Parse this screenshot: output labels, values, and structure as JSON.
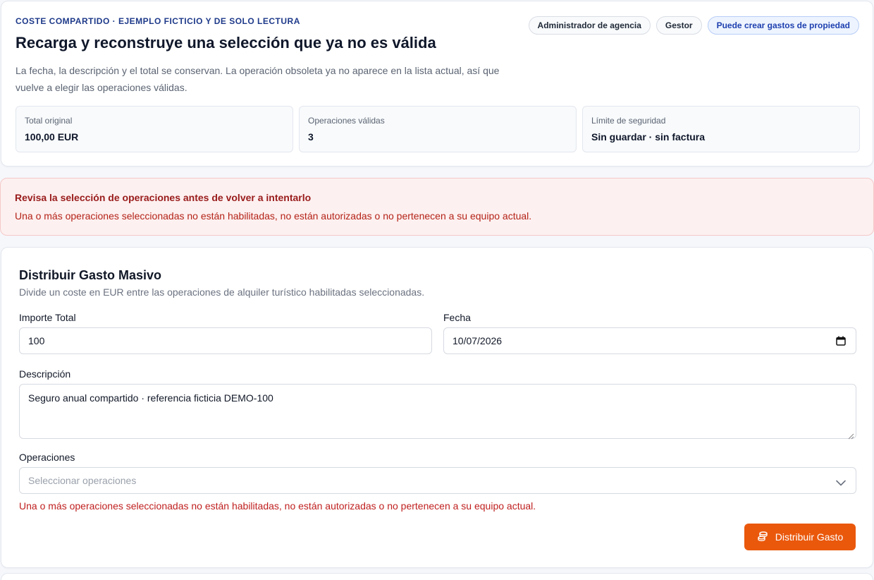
{
  "header": {
    "eyebrow": "COSTE COMPARTIDO · EJEMPLO FICTICIO Y DE SOLO LECTURA",
    "title": "Recarga y reconstruye una selección que ya no es válida",
    "subtitle": "La fecha, la descripción y el total se conservan. La operación obsoleta ya no aparece en la lista actual, así que vuelve a elegir las operaciones válidas.",
    "chips": [
      "Administrador de agencia",
      "Gestor",
      "Puede crear gastos de propiedad"
    ],
    "stats": [
      {
        "label": "Total original",
        "value": "100,00 EUR"
      },
      {
        "label": "Operaciones válidas",
        "value": "3"
      },
      {
        "label": "Límite de seguridad",
        "value": "Sin guardar · sin factura"
      }
    ]
  },
  "alert": {
    "title": "Revisa la selección de operaciones antes de volver a intentarlo",
    "text": "Una o más operaciones seleccionadas no están habilitadas, no están autorizadas o no pertenecen a su equipo actual."
  },
  "form": {
    "title": "Distribuir Gasto Masivo",
    "description": "Divide un coste en EUR entre las operaciones de alquiler turístico habilitadas seleccionadas.",
    "amount_label": "Importe Total",
    "amount_value": "100",
    "date_label": "Fecha",
    "date_value": "10/07/2026",
    "description_label": "Descripción",
    "description_value": "Seguro anual compartido · referencia ficticia DEMO-100",
    "operations_label": "Operaciones",
    "operations_placeholder": "Seleccionar operaciones",
    "operations_error": "Una o más operaciones seleccionadas no están habilitadas, no están autorizadas o no pertenecen a su equipo actual.",
    "submit_label": "Distribuir Gasto"
  },
  "icons": {
    "date": "calendar-icon",
    "select": "chevron-down-icon",
    "submit": "coins-icon"
  },
  "colors": {
    "accent": "#ea580c",
    "eyebrow": "#1e3a8a",
    "alert_background": "#fdf0f0",
    "alert_text": "#b42318"
  }
}
